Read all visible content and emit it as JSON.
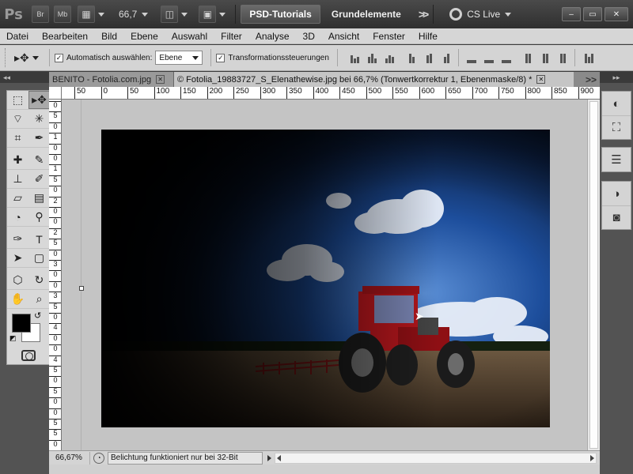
{
  "appbar": {
    "logo": "Ps",
    "bridge_label": "Br",
    "minibridge_label": "Mb",
    "zoom": "66,7",
    "workspace_active": "PSD-Tutorials",
    "workspace_2": "Grundelemente",
    "workspace_more": ">>",
    "cs_live": "CS Live",
    "win_min": "–",
    "win_max": "▭",
    "win_close": "✕"
  },
  "menu": [
    "Datei",
    "Bearbeiten",
    "Bild",
    "Ebene",
    "Auswahl",
    "Filter",
    "Analyse",
    "3D",
    "Ansicht",
    "Fenster",
    "Hilfe"
  ],
  "options": {
    "auto_select_label": "Automatisch auswählen:",
    "auto_select_checked": true,
    "auto_select_value": "Ebene",
    "transform_label": "Transformationssteuerungen",
    "transform_checked": true
  },
  "tabs": {
    "inactive_label": "BENITO - Fotolia.com.jpg",
    "active_label": "© Fotolia_19883727_S_Elenathewise.jpg bei 66,7% (Tonwertkorrektur 1, Ebenenmaske/8) *",
    "close_glyph": "✕",
    "more": ">>"
  },
  "ruler": {
    "h_ticks": [
      "50",
      "0",
      "50",
      "100",
      "150",
      "200",
      "250",
      "300",
      "350",
      "400",
      "450",
      "500",
      "550",
      "600",
      "650",
      "700",
      "750",
      "800",
      "850",
      "900"
    ],
    "v_ticks": [
      "0",
      "5",
      "0",
      "1",
      "0",
      "0",
      "1",
      "5",
      "0",
      "2",
      "0",
      "0",
      "2",
      "5",
      "0",
      "3",
      "0",
      "0",
      "3",
      "5",
      "0",
      "4",
      "0",
      "0",
      "4",
      "5",
      "0",
      "5",
      "0",
      "0",
      "5",
      "5",
      "0"
    ]
  },
  "status": {
    "zoom": "66,67%",
    "message": "Belichtung funktioniert nur bei 32-Bit"
  },
  "colors": {
    "foreground": "#000000",
    "background": "#ffffff",
    "sky": "#1d4e9c",
    "tractor_red": "#b3161c"
  },
  "tools": [
    [
      "marquee-tool",
      "move-tool"
    ],
    [
      "lasso-tool",
      "quick-selection-tool"
    ],
    [
      "crop-tool",
      "eyedropper-tool"
    ],
    [
      "healing-brush-tool",
      "brush-tool"
    ],
    [
      "clone-stamp-tool",
      "history-brush-tool"
    ],
    [
      "eraser-tool",
      "gradient-tool"
    ],
    [
      "blur-tool",
      "dodge-tool"
    ],
    [
      "pen-tool",
      "type-tool"
    ],
    [
      "path-selection-tool",
      "shape-tool"
    ],
    [
      "3d-rotate-tool",
      "3d-orbit-tool"
    ],
    [
      "hand-tool",
      "zoom-tool"
    ]
  ]
}
